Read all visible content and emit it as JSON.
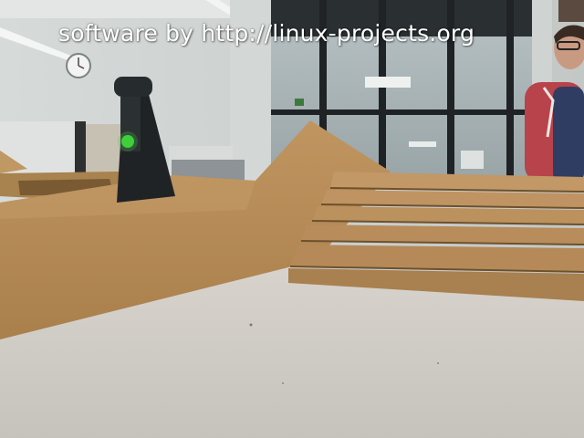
{
  "overlay": {
    "watermark_text": "software by http://linux-projects.org",
    "watermark_color": "#ffffff"
  },
  "scene": {
    "description_objects": [
      "ceiling-lights",
      "wall-clock",
      "office-partitions",
      "glass-wall",
      "traffic-signal",
      "wooden-ramp",
      "wooden-stairs",
      "concrete-floor",
      "person"
    ],
    "signal_light_color": "#3ecf3a",
    "wood_color": "#b58a55",
    "floor_color": "#cfccc6"
  }
}
